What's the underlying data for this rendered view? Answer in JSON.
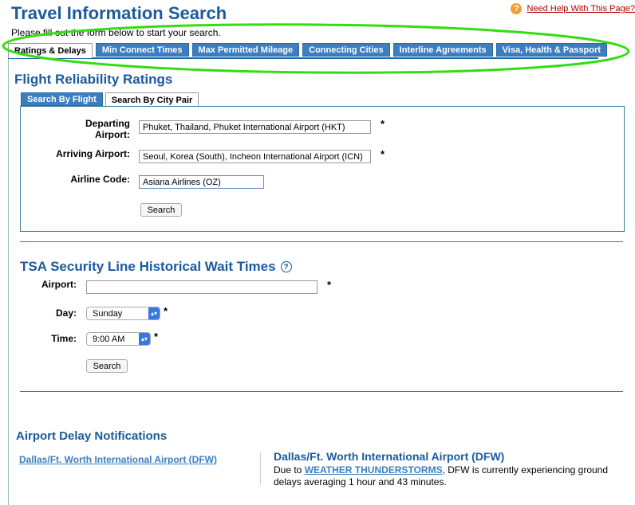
{
  "header": {
    "title": "Travel Information Search",
    "help_link": "Need Help With This Page?",
    "intro": "Please fill out the form below to start your search."
  },
  "tabs": [
    {
      "label": "Ratings & Delays",
      "active": true
    },
    {
      "label": "Min Connect Times",
      "active": false
    },
    {
      "label": "Max Permitted Mileage",
      "active": false
    },
    {
      "label": "Connecting Cities",
      "active": false
    },
    {
      "label": "Interline Agreements",
      "active": false
    },
    {
      "label": "Visa, Health & Passport",
      "active": false
    }
  ],
  "reliability": {
    "title": "Flight Reliability Ratings",
    "subtabs": [
      {
        "label": "Search By Flight",
        "active": false
      },
      {
        "label": "Search By City Pair",
        "active": true
      }
    ],
    "departing_label_1": "Departing",
    "departing_label_2": "Airport:",
    "departing_value": "Phuket, Thailand, Phuket International Airport (HKT)",
    "arriving_label": "Arriving Airport:",
    "arriving_value": "Seoul, Korea (South), Incheon International Airport (ICN)",
    "airline_label": "Airline Code:",
    "airline_value": "Asiana Airlines (OZ)",
    "search_button": "Search",
    "required_mark": "*"
  },
  "tsa": {
    "title": "TSA Security Line Historical Wait Times",
    "help_icon": "?",
    "airport_label": "Airport:",
    "airport_value": "",
    "day_label": "Day:",
    "day_value": "Sunday",
    "time_label": "Time:",
    "time_value": "9:00 AM",
    "search_button": "Search",
    "required_mark": "*"
  },
  "delays": {
    "title": "Airport Delay Notifications",
    "airport_link": "Dallas/Ft. Worth International Airport (DFW)",
    "notice_title": "Dallas/Ft. Worth International Airport (DFW)",
    "notice_prefix": "Due to ",
    "notice_link": "WEATHER THUNDERSTORMS",
    "notice_suffix": ", DFW is currently experiencing ground delays averaging 1 hour and 43 minutes."
  },
  "colors": {
    "accent": "#1a5a9e",
    "tab_bg": "#3b7fc1",
    "highlight_ellipse": "#33dd11"
  }
}
